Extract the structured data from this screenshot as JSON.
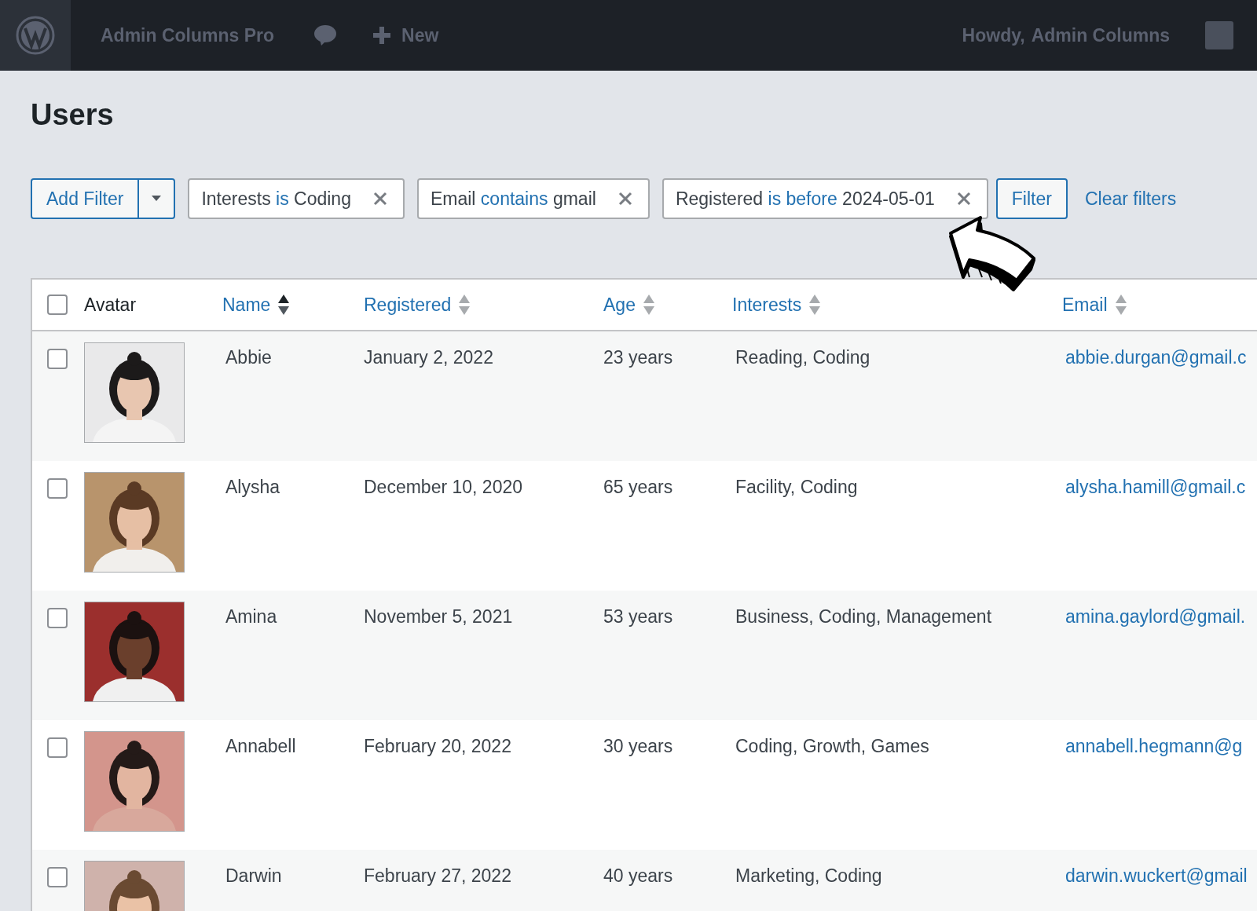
{
  "admin_bar": {
    "site_name": "Admin Columns Pro",
    "new_label": "New",
    "greeting": "Howdy,",
    "user_name": "Admin Columns"
  },
  "page_title": "Users",
  "filter_bar": {
    "add_filter": "Add Filter",
    "filters": [
      {
        "field": "Interests",
        "operator": "is",
        "value": "Coding"
      },
      {
        "field": "Email",
        "operator": "contains",
        "value": "gmail"
      },
      {
        "field": "Registered",
        "operator": "is before",
        "value": "2024-05-01"
      }
    ],
    "filter_button": "Filter",
    "clear_link": "Clear filters"
  },
  "table": {
    "select_all": {
      "checked": false
    },
    "columns": [
      {
        "label": "Avatar",
        "sortable": false,
        "sorted": false
      },
      {
        "label": "Name",
        "sortable": true,
        "sorted": true
      },
      {
        "label": "Registered",
        "sortable": true,
        "sorted": false
      },
      {
        "label": "Age",
        "sortable": true,
        "sorted": false
      },
      {
        "label": "Interests",
        "sortable": true,
        "sorted": false
      },
      {
        "label": "Email",
        "sortable": true,
        "sorted": false
      }
    ],
    "rows": [
      {
        "checked": false,
        "name": "Abbie",
        "registered": "January 2, 2022",
        "age": "23 years",
        "interests": "Reading, Coding",
        "email": "abbie.durgan@gmail.c"
      },
      {
        "checked": false,
        "name": "Alysha",
        "registered": "December 10, 2020",
        "age": "65 years",
        "interests": "Facility, Coding",
        "email": "alysha.hamill@gmail.c"
      },
      {
        "checked": false,
        "name": "Amina",
        "registered": "November 5, 2021",
        "age": "53 years",
        "interests": "Business, Coding, Management",
        "email": "amina.gaylord@gmail."
      },
      {
        "checked": false,
        "name": "Annabell",
        "registered": "February 20, 2022",
        "age": "30 years",
        "interests": "Coding, Growth, Games",
        "email": "annabell.hegmann@g"
      },
      {
        "checked": false,
        "name": "Darwin",
        "registered": "February 27, 2022",
        "age": "40 years",
        "interests": "Marketing, Coding",
        "email": "darwin.wuckert@gmail"
      }
    ]
  }
}
